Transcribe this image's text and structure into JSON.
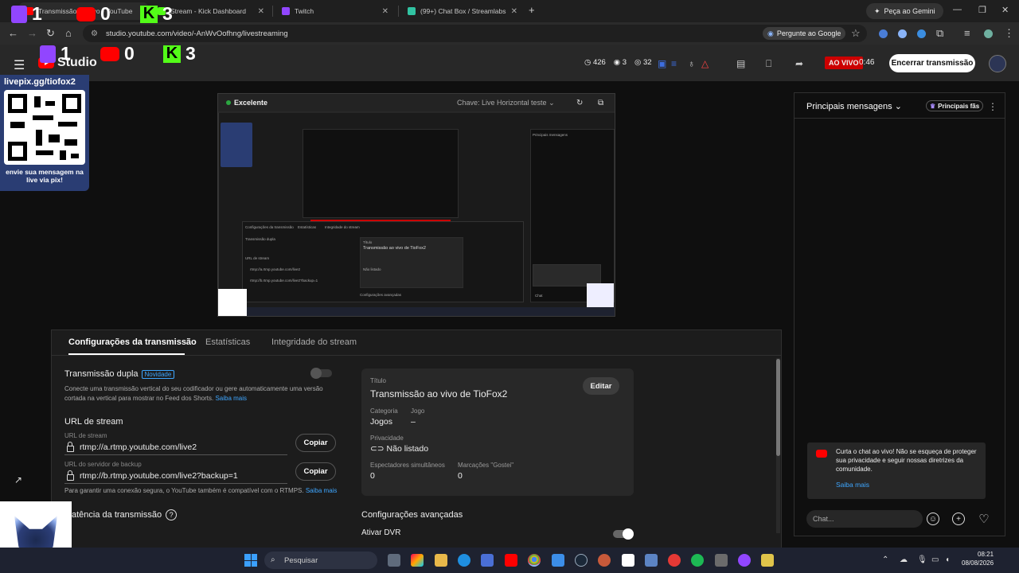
{
  "browser": {
    "tabs": [
      {
        "label": "Transmissão ao vivo - YouTube"
      },
      {
        "label": "Stream - Kick Dashboard"
      },
      {
        "label": "Twitch"
      },
      {
        "label": "(99+) Chat Box / Streamlabs"
      }
    ],
    "gemini_label": "Peça ao Gemini",
    "url": "studio.youtube.com/video/-AnWvOofhng/livestreaming",
    "ask_google": "Pergunte ao Google"
  },
  "studio": {
    "logo": "Studio",
    "stats": {
      "viewers": "426",
      "watching": "3",
      "views": "32"
    },
    "live_badge": "AO VIVO",
    "live_time": "0:46",
    "end_button": "Encerrar transmissão"
  },
  "overlay": {
    "twitch_count": "1",
    "youtube_count": "0",
    "kick_count": "3",
    "qr_title": "livepix.gg/tiofox2",
    "qr_caption": "envie sua mensagem na live via pix!"
  },
  "preview": {
    "quality": "Excelente",
    "key_label": "Chave: Live Horizontal teste",
    "mini_text": [
      "Configurações da transmissão",
      "Estatísticas",
      "Integridade do stream",
      "Transmissão dupla",
      "URL de stream",
      "rtmp://a.rtmp.youtube.com/live2",
      "rtmp://b.rtmp.youtube.com/live2?backup=1",
      "Título",
      "Transmissão ao vivo de TioFox2",
      "Não listado",
      "Configurações avançadas",
      "Principais mensagens",
      "Chat"
    ]
  },
  "tabs": {
    "config": "Configurações da transmissão",
    "stats": "Estatísticas",
    "health": "Integridade do stream"
  },
  "settings": {
    "dual_title": "Transmissão dupla",
    "new_badge": "Novidade",
    "dual_desc": "Conecte uma transmissão vertical do seu codificador ou gere automaticamente uma versão cortada na vertical para mostrar no Feed dos Shorts.",
    "learn_more": "Saiba mais",
    "stream_url_title": "URL de stream",
    "stream_url_label": "URL de stream",
    "stream_url": "rtmp://a.rtmp.youtube.com/live2",
    "backup_label": "URL do servidor de backup",
    "backup_url": "rtmp://b.rtmp.youtube.com/live2?backup=1",
    "copy": "Copiar",
    "secure_note": "Para garantir uma conexão segura, o YouTube também é compatível com o RTMPS.",
    "latency_title": "atência da transmissão"
  },
  "info": {
    "title_label": "Título",
    "title": "Transmissão ao vivo de TioFox2",
    "edit": "Editar",
    "category_label": "Categoria",
    "category": "Jogos",
    "game_label": "Jogo",
    "game": "–",
    "privacy_label": "Privacidade",
    "privacy": "Não listado",
    "concurrent_label": "Espectadores simultâneos",
    "concurrent": "0",
    "likes_label": "Marcações \"Gostei\"",
    "likes": "0",
    "advanced": "Configurações avançadas",
    "dvr": "Ativar DVR"
  },
  "chat": {
    "header": "Principais mensagens",
    "top_fans": "Principais fãs",
    "notice": "Curta o chat ao vivo! Não se esqueça de proteger sua privacidade e seguir nossas diretrizes da comunidade.",
    "notice_link": "Saiba mais",
    "placeholder": "Chat..."
  },
  "taskbar": {
    "search": "Pesquisar",
    "time": "08:21",
    "date": "08/08/2026"
  },
  "colors": {
    "youtube_red": "#ff0000",
    "twitch_purple": "#9146ff",
    "kick_green": "#53fc18",
    "link_blue": "#3ea6ff"
  }
}
